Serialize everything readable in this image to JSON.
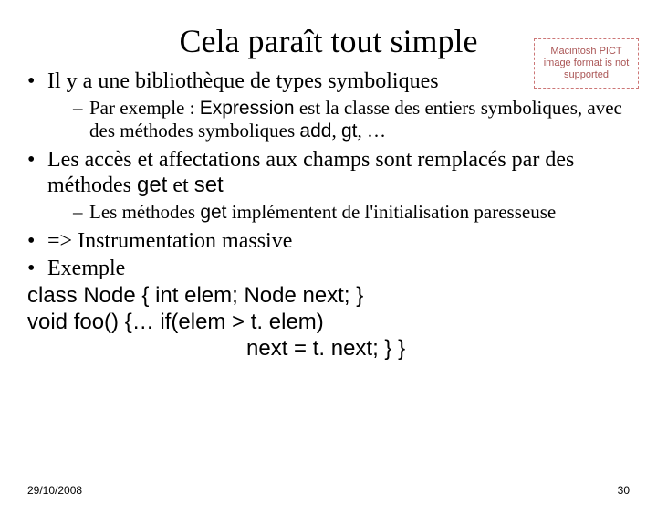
{
  "title": "Cela paraît tout simple",
  "placeholder_text": "Macintosh PICT image format is not supported",
  "bullet1": "Il y a une bibliothèque de types symboliques",
  "sub1_a": "Par exemple : ",
  "sub1_b": "Expression",
  "sub1_c": " est la classe des entiers symboliques, avec des méthodes symboliques ",
  "sub1_d": "add",
  "sub1_e": ", ",
  "sub1_f": "gt",
  "sub1_g": ", …",
  "bullet2_a": "Les accès et affectations aux champs sont remplacés par des méthodes ",
  "bullet2_b": "get",
  "bullet2_c": " et ",
  "bullet2_d": "set",
  "sub2_a": "Les méthodes ",
  "sub2_b": "get",
  "sub2_c": " implémentent de l'initialisation paresseuse",
  "bullet3": "=> Instrumentation massive",
  "bullet4": "Exemple",
  "code_line1": "class Node { int elem; Node next; }",
  "code_line2": "void foo() {… if(elem > t. elem)",
  "code_line3": "next = t. next; } }",
  "footer_date": "29/10/2008",
  "footer_page": "30"
}
